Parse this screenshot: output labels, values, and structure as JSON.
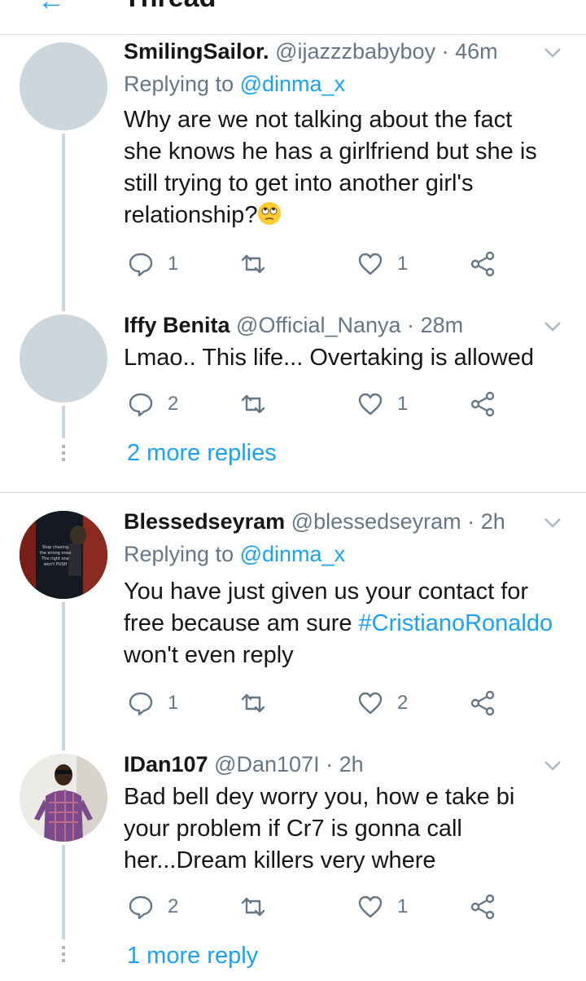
{
  "header": {
    "title": "Thread",
    "back_icon": "back-arrow-icon"
  },
  "tweets": [
    {
      "name": "SmilingSailor.",
      "handle": "@ijazzzbabyboy",
      "time": "46m",
      "replying_prefix": "Replying to",
      "replying_to": "@dinma_x",
      "lines": [
        "Why are we not talking about the fact",
        "she knows he has a girlfriend but she is",
        "still trying to get into another girl's",
        "relationship?"
      ],
      "emoji": "face-with-rolling-eyes-icon",
      "replies": "1",
      "retweets": "",
      "likes": "1"
    },
    {
      "name": "Iffy Benita",
      "handle": "@Official_Nanya",
      "time": "28m",
      "lines": [
        "Lmao.. This life... Overtaking is allowed"
      ],
      "replies": "2",
      "retweets": "",
      "likes": "1"
    },
    {
      "name": "Blessedseyram",
      "handle": "@blessedseyram",
      "time": "2h",
      "replying_prefix": "Replying to",
      "replying_to": "@dinma_x",
      "lines": [
        "You have just given us your contact for",
        "free because am sure ",
        "won't even reply"
      ],
      "hashtag": "#CristianoRonaldo",
      "replies": "1",
      "retweets": "",
      "likes": "2"
    },
    {
      "name": "IDan107",
      "handle": "@Dan107I",
      "time": "2h",
      "lines": [
        "Bad bell dey worry you, how e take bi",
        "your problem if Cr7 is gonna call",
        "her...Dream killers very where"
      ],
      "replies": "2",
      "retweets": "",
      "likes": "1"
    }
  ],
  "more_replies": [
    "2 more replies",
    "1 more reply"
  ],
  "avatar_image_text": [
    "Stop chasing",
    "the wrong ones",
    "The right one",
    "won't PUSH"
  ],
  "colors": {
    "accent": "#1da1f2",
    "text": "#14171a",
    "muted": "#657786",
    "line": "#ccd6dd",
    "divider": "#d9dde0"
  }
}
